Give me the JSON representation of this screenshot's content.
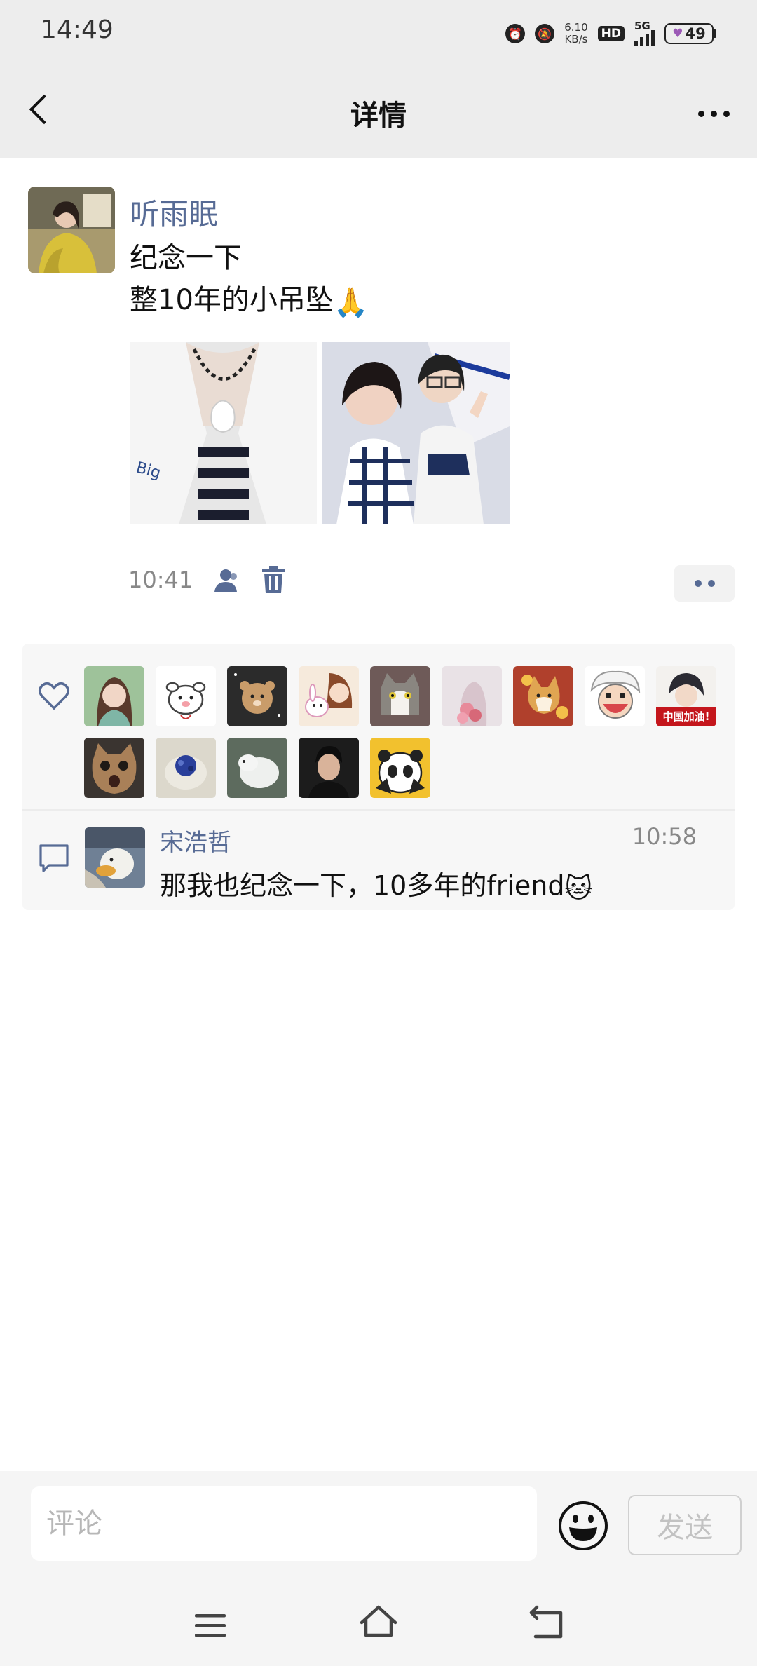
{
  "status_bar": {
    "time": "14:49",
    "net_speed_value": "6.10",
    "net_speed_unit": "KB/s",
    "hd_label": "HD",
    "network_label": "5G",
    "battery": "49"
  },
  "header": {
    "title": "详情"
  },
  "post": {
    "author": "听雨眠",
    "text_line1": "纪念一下",
    "text_line2": "整10年的小吊坠",
    "text_emoji": "🙏",
    "time": "10:41",
    "photos": [
      "pendant-photo",
      "selfie-photo"
    ]
  },
  "likes": {
    "count_shown": 14,
    "avatars": [
      "woman-portrait-avatar",
      "white-cartoon-dog-avatar",
      "kumamon-bear-avatar",
      "anime-girl-rabbit-avatar",
      "cat-avatar",
      "girl-flowers-avatar",
      "shiba-dog-avatar",
      "luffy-gear5-avatar",
      "china-jiayou-avatar",
      "tabby-cat-avatar",
      "blue-berry-avatar",
      "white-dog-avatar",
      "man-portrait-avatar",
      "panda-meme-avatar"
    ],
    "china_avatar_text": "中国加油!"
  },
  "comments": [
    {
      "author": "宋浩哲",
      "time": "10:58",
      "text": "那我也纪念一下，10多年的friend",
      "emoji": "🐱"
    }
  ],
  "input": {
    "placeholder": "评论",
    "send_label": "发送"
  },
  "colors": {
    "link": "#576b95",
    "header_bg": "#ededed"
  }
}
